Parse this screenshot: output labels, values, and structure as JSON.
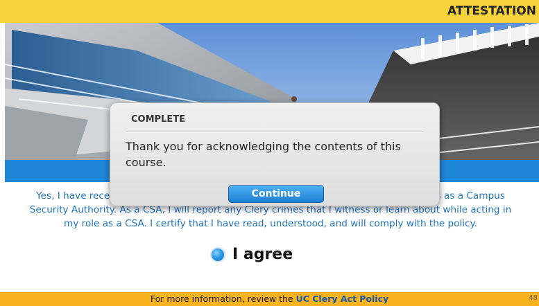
{
  "header": {
    "title": "ATTESTATION"
  },
  "body": {
    "line1_left": "Yes, I have rece",
    "line1_right": "es as a Campus",
    "line2": "Security Authority. As a CSA, I will report any Clery crimes that I witness or learn about while acting in",
    "line3": "my role as a CSA. I certify that I have read, understood, and will comply with the policy."
  },
  "agree": {
    "label": "I agree",
    "selected": true
  },
  "footer": {
    "text_prefix": "For more information, review the ",
    "link": "UC Clery Act Policy",
    "page_number": "48"
  },
  "modal": {
    "title": "COMPLETE",
    "message": "Thank you for acknowledging the contents of this course.",
    "button": "Continue"
  },
  "colors": {
    "header_yellow": "#f7d23a",
    "footer_orange": "#f7b21e",
    "accent_blue": "#1e86d6",
    "body_text_blue": "#1f73c0"
  }
}
